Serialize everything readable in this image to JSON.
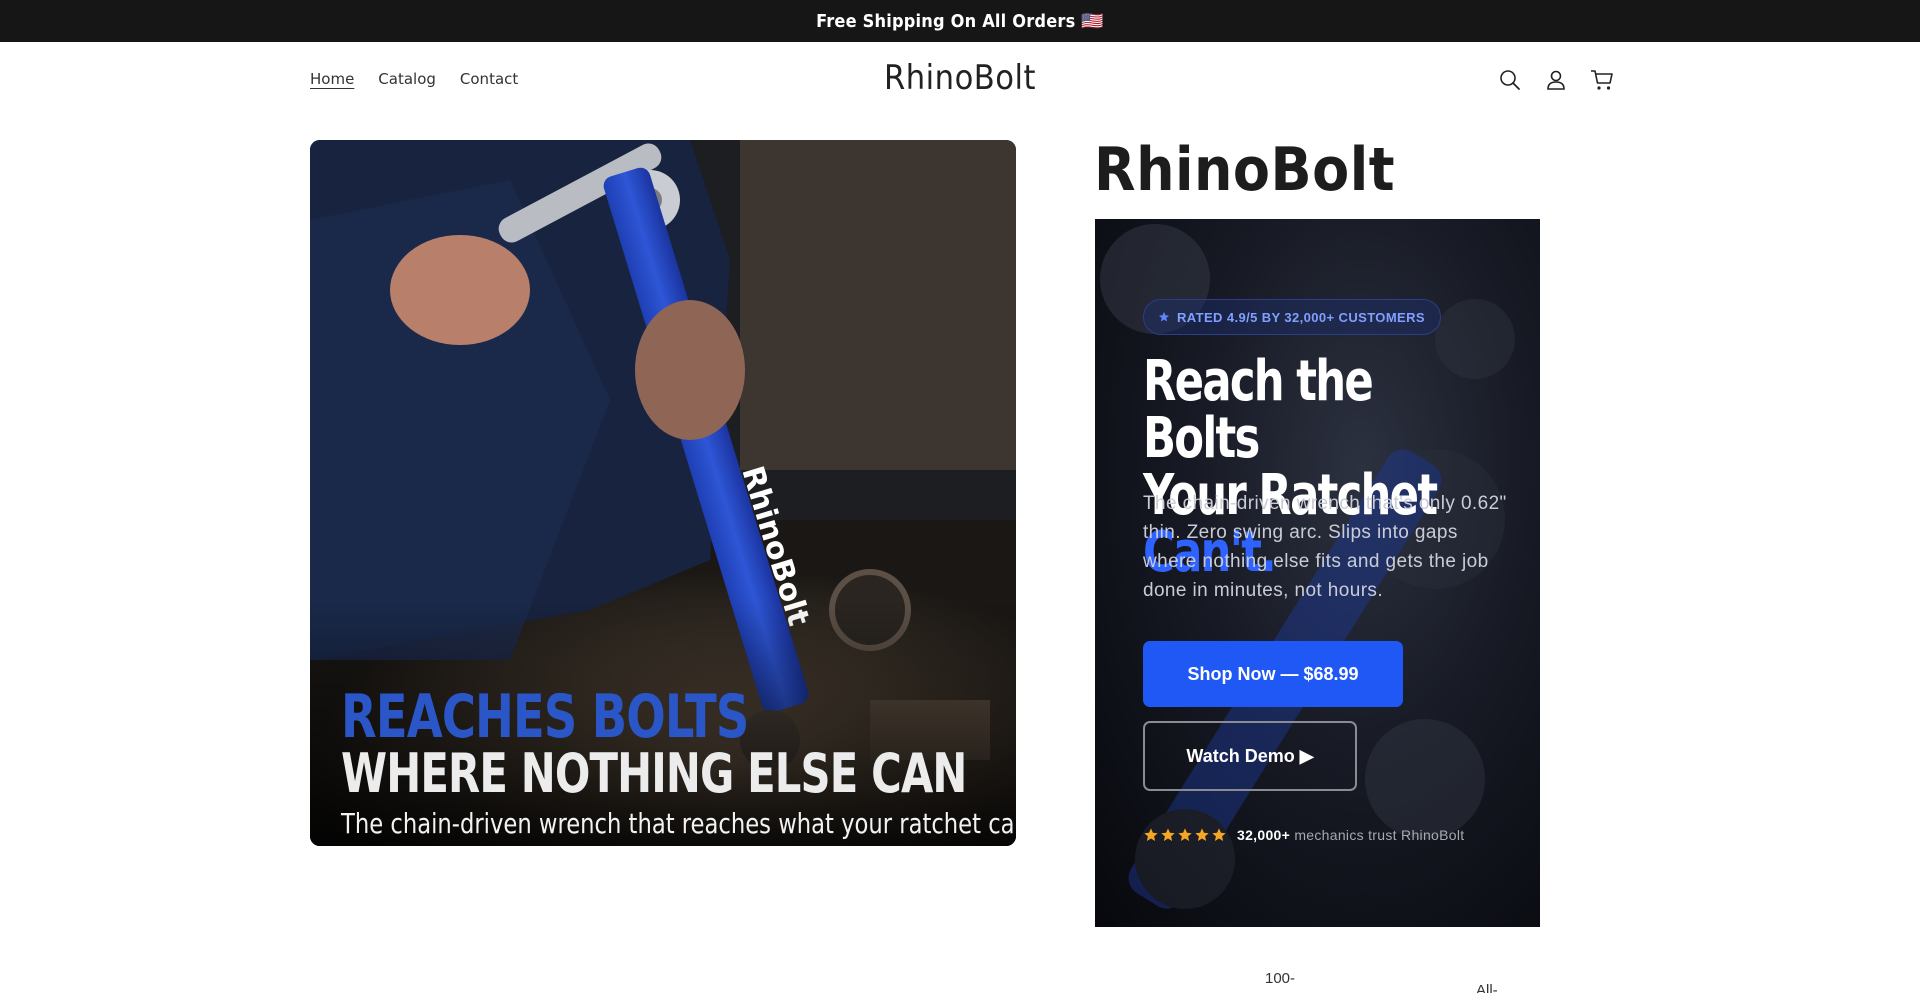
{
  "announcement": {
    "text": "Free Shipping On All Orders 🇺🇸"
  },
  "header": {
    "nav": [
      {
        "label": "Home",
        "active": true
      },
      {
        "label": "Catalog",
        "active": false
      },
      {
        "label": "Contact",
        "active": false
      }
    ],
    "logo": "RhinoBolt",
    "icons": [
      "search-icon",
      "account-icon",
      "cart-icon"
    ]
  },
  "hero_image": {
    "tool_brand": "RhinoBolt",
    "headline_line1": "REACHES BOLTS",
    "headline_line2": "WHERE NOTHING ELSE CAN",
    "subline": "The chain-driven wrench that reaches what your ratchet can't"
  },
  "product": {
    "title": "RhinoBolt"
  },
  "promo": {
    "badge": "RATED 4.9/5 BY 32,000+ CUSTOMERS",
    "headline_line1": "Reach the Bolts",
    "headline_line2": "Your Ratchet",
    "headline_accent": "Can't.",
    "description": "The chain-driven wrench that's only 0.62\" thin. Zero swing arc. Slips into gaps where nothing else fits and gets the job done in minutes, not hours.",
    "primary_button": "Shop Now — $68.99",
    "secondary_button": "Watch Demo ▶",
    "rating_stars": 5,
    "trust_count": "32,000+",
    "trust_text": "mechanics trust RhinoBolt",
    "colors": {
      "accent": "#2f63ff",
      "button": "#1f58f5",
      "star": "#f5a623"
    }
  },
  "below_fold": {
    "peek_left": "100-",
    "peek_right": "All-"
  }
}
